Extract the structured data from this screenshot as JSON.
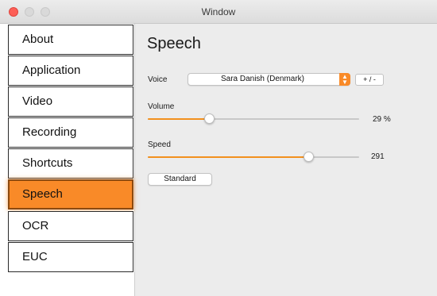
{
  "window": {
    "title": "Window"
  },
  "sidebar": {
    "items": [
      {
        "label": "About"
      },
      {
        "label": "Application"
      },
      {
        "label": "Video"
      },
      {
        "label": "Recording"
      },
      {
        "label": "Shortcuts"
      },
      {
        "label": "Speech",
        "selected": true
      },
      {
        "label": "OCR"
      },
      {
        "label": "EUC"
      }
    ]
  },
  "main": {
    "title": "Speech",
    "voice": {
      "label": "Voice",
      "selected": "Sara Danish (Denmark)",
      "adjust_label": "+ / -"
    },
    "volume": {
      "label": "Volume",
      "value": 29,
      "fraction": 0.29,
      "readout": "29  %"
    },
    "speed": {
      "label": "Speed",
      "value": 291,
      "fraction": 0.76,
      "readout": "291"
    },
    "standard_button": "Standard"
  },
  "colors": {
    "accent": "#f98a28",
    "selected_border": "#8b4a10",
    "close_button": "#fd5f57"
  },
  "icons": [
    "close-icon",
    "minimize-icon",
    "maximize-icon",
    "updown-arrows-icon"
  ]
}
